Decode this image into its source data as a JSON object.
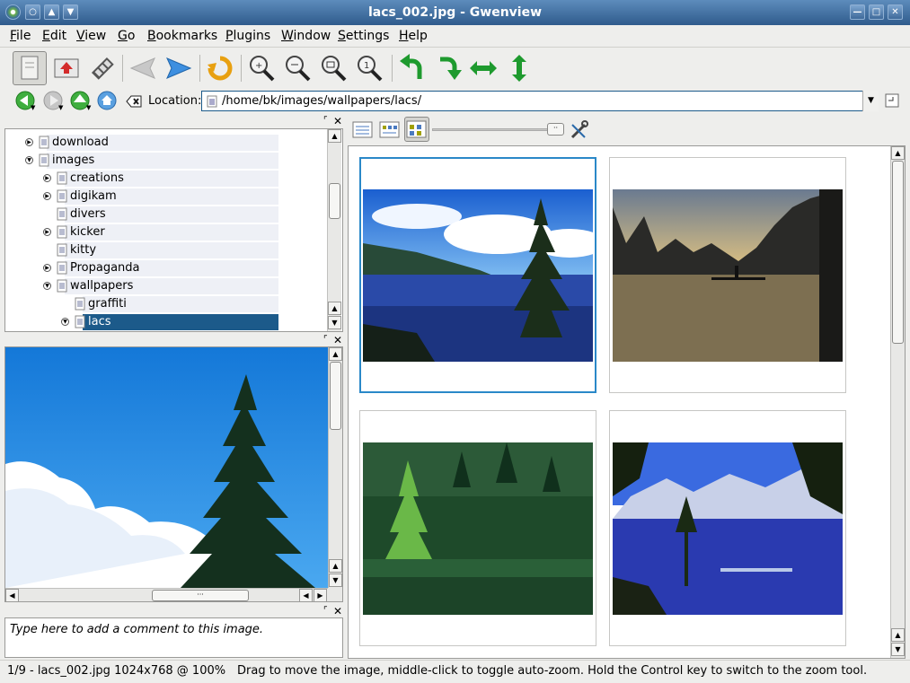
{
  "window": {
    "title": "lacs_002.jpg - Gwenview"
  },
  "menu": [
    "File",
    "Edit",
    "View",
    "Go",
    "Bookmarks",
    "Plugins",
    "Window",
    "Settings",
    "Help"
  ],
  "location": {
    "label": "Location:",
    "path": "/home/bk/images/wallpapers/lacs/"
  },
  "tree": {
    "items": [
      {
        "label": "download",
        "expander": "collapsed",
        "level": 1
      },
      {
        "label": "images",
        "expander": "expanded",
        "level": 1
      },
      {
        "label": "creations",
        "expander": "collapsed",
        "level": 2
      },
      {
        "label": "digikam",
        "expander": "collapsed",
        "level": 2
      },
      {
        "label": "divers",
        "expander": "none",
        "level": 2
      },
      {
        "label": "kicker",
        "expander": "collapsed",
        "level": 2
      },
      {
        "label": "kitty",
        "expander": "none",
        "level": 2
      },
      {
        "label": "Propaganda",
        "expander": "collapsed",
        "level": 2
      },
      {
        "label": "wallpapers",
        "expander": "expanded",
        "level": 2
      },
      {
        "label": "graffiti",
        "expander": "none",
        "level": 3
      },
      {
        "label": "lacs",
        "expander": "expanded",
        "level": 3,
        "selected": true
      }
    ]
  },
  "comment": {
    "placeholder": "Type here to add a comment to this image."
  },
  "status": {
    "info": "1/9 - lacs_002.jpg 1024x768 @ 100%",
    "hint": "Drag to move the image, middle-click to toggle auto-zoom. Hold the Control key to switch to the zoom tool."
  },
  "gallery": {
    "count": 4,
    "selected_index": 0
  },
  "colors": {
    "accent": "#2a88c8",
    "selection": "#1c5a8a",
    "titlebar": "#3f6a9a"
  }
}
